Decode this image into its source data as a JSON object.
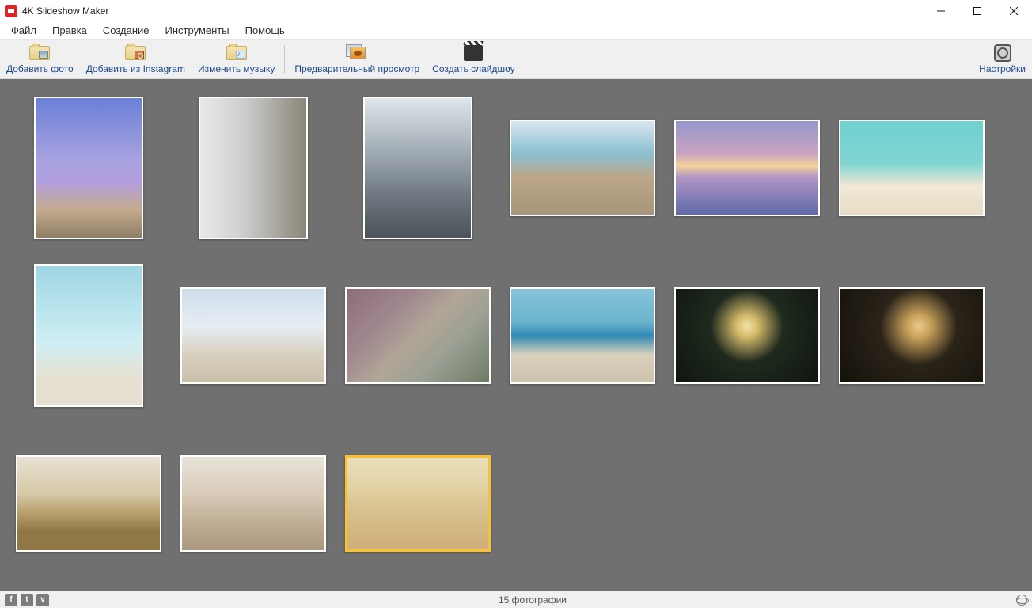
{
  "window": {
    "title": "4K Slideshow Maker"
  },
  "menubar": {
    "items": [
      {
        "label": "Файл"
      },
      {
        "label": "Правка"
      },
      {
        "label": "Создание"
      },
      {
        "label": "Инструменты"
      },
      {
        "label": "Помощь"
      }
    ]
  },
  "toolbar": {
    "add_photo": "Добавить фото",
    "add_instagram": "Добавить из Instagram",
    "change_music": "Изменить музыку",
    "preview": "Предварительный просмотр",
    "create_slideshow": "Создать слайдшоу",
    "settings": "Настройки"
  },
  "photos": [
    {
      "name": "eiffel-tower",
      "orientation": "portrait",
      "style": "ph-eiffel",
      "selected": false
    },
    {
      "name": "woman-window",
      "orientation": "portrait",
      "style": "ph-woman-window",
      "selected": false
    },
    {
      "name": "city-skyline",
      "orientation": "portrait",
      "style": "ph-city",
      "selected": false
    },
    {
      "name": "beach-walk",
      "orientation": "landscape",
      "style": "ph-beach-walk",
      "selected": false
    },
    {
      "name": "sunset-heart",
      "orientation": "landscape",
      "style": "ph-sunset",
      "selected": false
    },
    {
      "name": "teal-beach",
      "orientation": "landscape",
      "style": "ph-beach-teal",
      "selected": false
    },
    {
      "name": "kneel-beach",
      "orientation": "portrait",
      "style": "ph-kneel-beach",
      "selected": false
    },
    {
      "name": "lifeguard",
      "orientation": "landscape",
      "style": "ph-lifeguard",
      "selected": false
    },
    {
      "name": "family-kiss",
      "orientation": "landscape",
      "style": "ph-family",
      "selected": false
    },
    {
      "name": "hat-beach",
      "orientation": "landscape",
      "style": "ph-hat-beach",
      "selected": false
    },
    {
      "name": "christmas-tree-1",
      "orientation": "landscape",
      "style": "ph-tree1",
      "selected": false
    },
    {
      "name": "christmas-tree-2",
      "orientation": "landscape",
      "style": "ph-tree2",
      "selected": false
    },
    {
      "name": "wedding-rings",
      "orientation": "landscape",
      "style": "ph-rings",
      "selected": false
    },
    {
      "name": "wedding-couple",
      "orientation": "landscape",
      "style": "ph-wedding",
      "selected": false
    },
    {
      "name": "baby",
      "orientation": "landscape",
      "style": "ph-baby",
      "selected": true
    }
  ],
  "statusbar": {
    "social": [
      "f",
      "t",
      "v"
    ],
    "count_text": "15 фотографии"
  }
}
